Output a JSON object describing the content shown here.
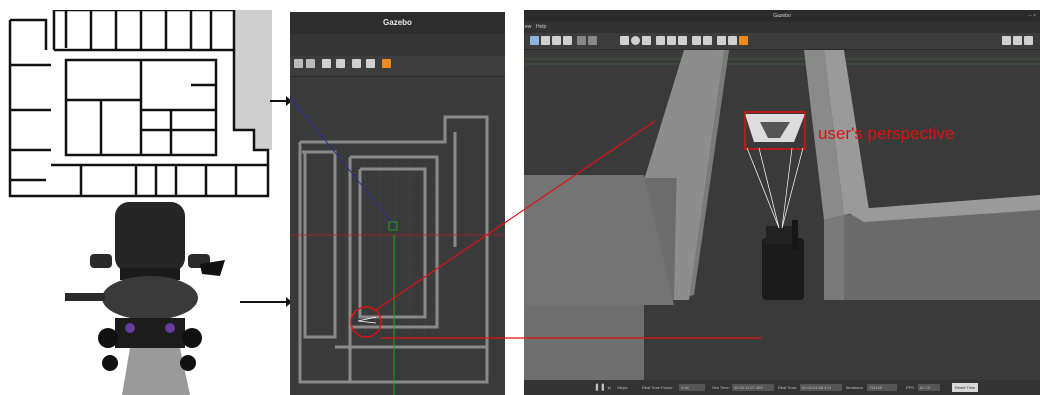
{
  "gazebo_small": {
    "title": "Gazebo"
  },
  "gazebo_large": {
    "title": "Gazebo",
    "menu": [
      "ew",
      "Help"
    ],
    "window_controls": "– ×",
    "status": {
      "pause_icon": "pause-icon",
      "steps_label": "Steps:",
      "rtf_label": "Real Time Factor:",
      "rtf_value": "0.84",
      "sim_time_label": "Sim Time:",
      "sim_time_value": "00 00:11:27.459",
      "real_time_label": "Real Time:",
      "real_time_value": "00 00:04:58.474",
      "iterations_label": "Iterations:",
      "iterations_value": "731109",
      "fps_label": "FPS:",
      "fps_value": "62.23",
      "reset_label": "Reset Time"
    }
  },
  "annotation": {
    "perspective_label": "user's perspective"
  },
  "colors": {
    "highlight": "#e01010",
    "pose_line": "#2a2a9a",
    "axis_green": "#1fa01f",
    "axis_red": "#b02020"
  }
}
